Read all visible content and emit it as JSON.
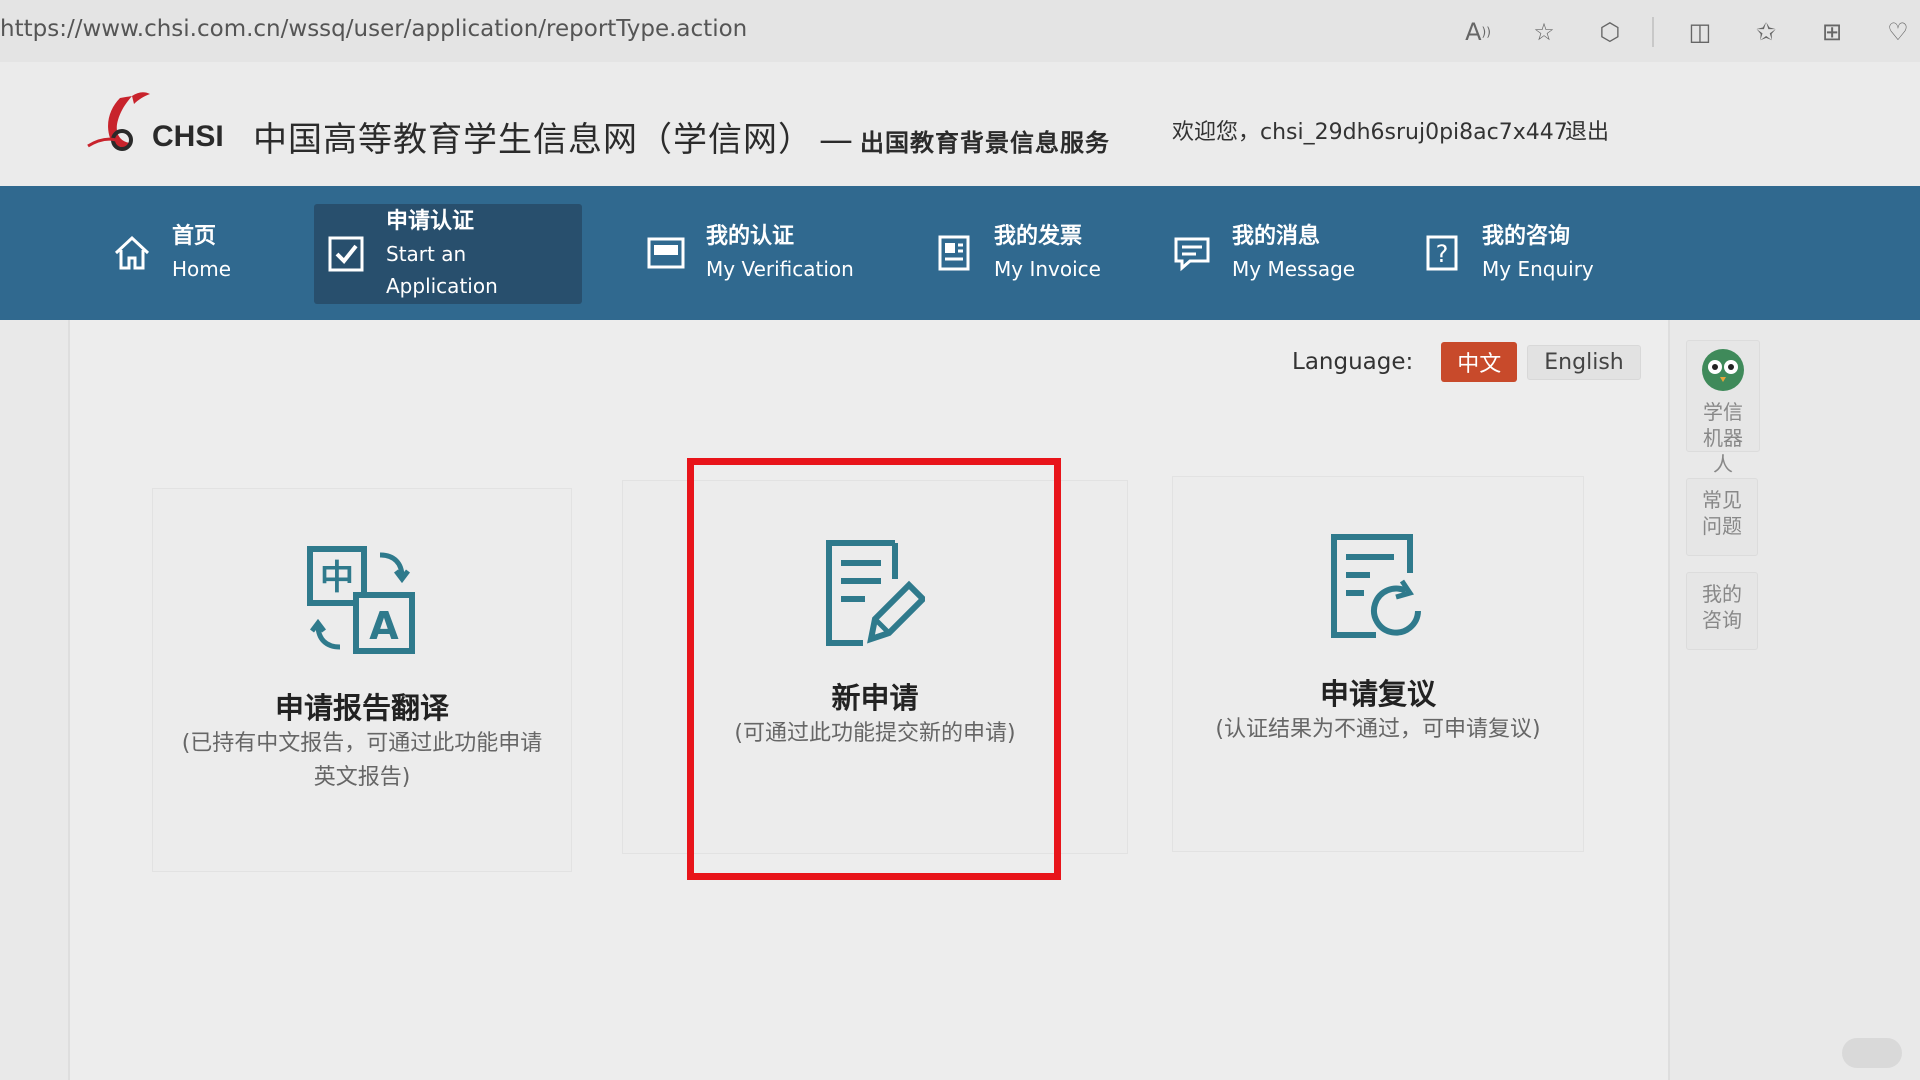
{
  "browser": {
    "url": "https://www.chsi.com.cn/wssq/user/application/reportType.action",
    "icons": [
      "read-aloud-icon",
      "favorite-star-icon",
      "extensions-icon",
      "split-screen-icon",
      "favorites-icon",
      "collections-icon",
      "browser-essentials-icon"
    ]
  },
  "header": {
    "logo_text": "CHSI",
    "site_title": "中国高等教育学生信息网（学信网）",
    "title_separator": "—",
    "site_subtitle": "出国教育背景信息服务",
    "welcome": "欢迎您，chsi_29dh6sruj0pi8ac7x447",
    "logout": "退出"
  },
  "nav": {
    "items": [
      {
        "cn": "首页",
        "en": "Home",
        "icon": "home-icon"
      },
      {
        "cn": "申请认证",
        "en": "Start an Application",
        "icon": "checkbox-icon",
        "active": true
      },
      {
        "cn": "我的认证",
        "en": "My Verification",
        "icon": "certificate-icon"
      },
      {
        "cn": "我的发票",
        "en": "My Invoice",
        "icon": "invoice-icon"
      },
      {
        "cn": "我的消息",
        "en": "My Message",
        "icon": "message-icon"
      },
      {
        "cn": "我的咨询",
        "en": "My Enquiry",
        "icon": "enquiry-icon"
      }
    ]
  },
  "language": {
    "label": "Language:",
    "options": [
      "中文",
      "English"
    ],
    "selected": "中文"
  },
  "cards": [
    {
      "title": "申请报告翻译",
      "desc": "(已持有中文报告，可通过此功能申请英文报告)",
      "icon": "translate-icon"
    },
    {
      "title": "新申请",
      "desc": "(可通过此功能提交新的申请)",
      "icon": "new-application-icon"
    },
    {
      "title": "申请复议",
      "desc": "(认证结果为不通过，可申请复议)",
      "icon": "reconsideration-icon"
    }
  ],
  "sidebar": {
    "robot": "学信机器人",
    "faq": "常见问题",
    "my_enquiry": "我的咨询"
  },
  "colors": {
    "nav_bg": "#30698f",
    "nav_active": "#284f6d",
    "lang_selected": "#c84a2b",
    "highlight": "#e8141a",
    "icon_teal": "#2f7a8c"
  }
}
